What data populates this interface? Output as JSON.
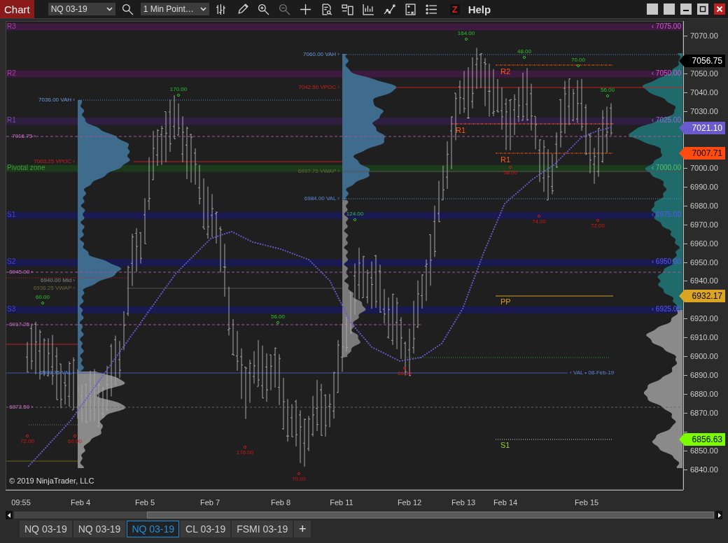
{
  "toolbar": {
    "title": "Chart",
    "instrument": "NQ 03-19",
    "interval": "1 Min Point…",
    "z_button": "Z",
    "help": "Help"
  },
  "chart": {
    "zones": [
      {
        "label": "R3",
        "price": "‹ 7075.00",
        "color": "#3e1a40"
      },
      {
        "label": "R2",
        "price": "‹ 7050.00",
        "color": "#3e1a40"
      },
      {
        "label": "R1",
        "price": "‹ 7025.00",
        "color": "#2e1e42"
      },
      {
        "label": "Pivotal zone",
        "price": "‹ 7000.00",
        "color": "#1a3a1a"
      },
      {
        "label": "S1",
        "price": "‹ 6975.00",
        "color": "#1a1a52"
      },
      {
        "label": "S2",
        "price": "‹ 6950.00",
        "color": "#1a1a52"
      },
      {
        "label": "S3",
        "price": "‹ 6925.00",
        "color": "#1a1a52"
      }
    ],
    "profile_labels": [
      {
        "text": "7036.00 VAH ›",
        "kind": "vah"
      },
      {
        "text": "7016.75 ›",
        "kind": "level"
      },
      {
        "text": "7003.25 VPOC ›",
        "kind": "vpoc"
      },
      {
        "text": "6945.00 ›",
        "kind": "level"
      },
      {
        "text": "6940.00 Mid ›",
        "kind": "mid"
      },
      {
        "text": "6936.25 VWAP ›",
        "kind": "vwap"
      },
      {
        "text": "6917.25 ›",
        "kind": "level"
      },
      {
        "text": "6899.75 VAL ›",
        "kind": "val"
      },
      {
        "text": "6873.50 ›",
        "kind": "level"
      },
      {
        "text": "7060.00 VAH ›",
        "kind": "vah"
      },
      {
        "text": "7042.50 VPOC ›",
        "kind": "vpoc"
      },
      {
        "text": "6997.75 VWAP ›",
        "kind": "vwap"
      },
      {
        "text": "6984.00 VAL ›",
        "kind": "val"
      }
    ],
    "val_note": "‹ VAL • 08-Feb-19",
    "swing_labels": [
      {
        "text": "60.00",
        "kind": "high"
      },
      {
        "text": "170.00",
        "kind": "high"
      },
      {
        "text": "56.00",
        "kind": "high"
      },
      {
        "text": "124.00",
        "kind": "high"
      },
      {
        "text": "164.00",
        "kind": "high"
      },
      {
        "text": "48.00",
        "kind": "high"
      },
      {
        "text": "70.00",
        "kind": "high"
      },
      {
        "text": "56.00",
        "kind": "high"
      },
      {
        "text": "72.00",
        "kind": "low"
      },
      {
        "text": "60.00",
        "kind": "low"
      },
      {
        "text": "176.00",
        "kind": "low"
      },
      {
        "text": "70.00",
        "kind": "low"
      },
      {
        "text": "66.00",
        "kind": "low"
      },
      {
        "text": "58.00",
        "kind": "low"
      },
      {
        "text": "74.00",
        "kind": "low"
      },
      {
        "text": "72.00",
        "kind": "low"
      }
    ],
    "pivot_labels": [
      {
        "text": "R2",
        "color": "#ff5a1a"
      },
      {
        "text": "R1",
        "color": "#ff5a1a"
      },
      {
        "text": "R1",
        "color": "#ff5a1a"
      },
      {
        "text": "PP",
        "color": "#d4a020"
      },
      {
        "text": "S1",
        "color": "#9acd32"
      }
    ],
    "copyright": "© 2019 NinjaTrader, LLC",
    "price_axis": [
      "7070.00",
      "7050.00",
      "7040.00",
      "7030.00",
      "7000.00",
      "6990.00",
      "6980.00",
      "6970.00",
      "6960.00",
      "6950.00",
      "6940.00",
      "6920.00",
      "6910.00",
      "6900.00",
      "6890.00",
      "6880.00",
      "6870.00",
      "6850.00",
      "6840.00"
    ],
    "price_tags": [
      {
        "text": "7056.75",
        "color": "#000000"
      },
      {
        "text": "7021.10",
        "color": "#6a5acd"
      },
      {
        "text": "7007.71",
        "color": "#ff4a10"
      },
      {
        "text": "6932.17",
        "color": "#daa520"
      },
      {
        "text": "6856.63",
        "color": "#7cfc00"
      }
    ],
    "time_axis": [
      "09:55",
      "Feb 4",
      "Feb 5",
      "Feb 7",
      "Feb 8",
      "Feb 11",
      "Feb 12",
      "Feb 13",
      "Feb 14",
      "Feb 15"
    ]
  },
  "tabs": [
    {
      "label": "NQ 03-19",
      "selected": false
    },
    {
      "label": "NQ 03-19",
      "selected": false
    },
    {
      "label": "NQ 03-19",
      "selected": true
    },
    {
      "label": "CL 03-19",
      "selected": false
    },
    {
      "label": "FSMI 03-19",
      "selected": false
    }
  ],
  "add_tab": "+"
}
